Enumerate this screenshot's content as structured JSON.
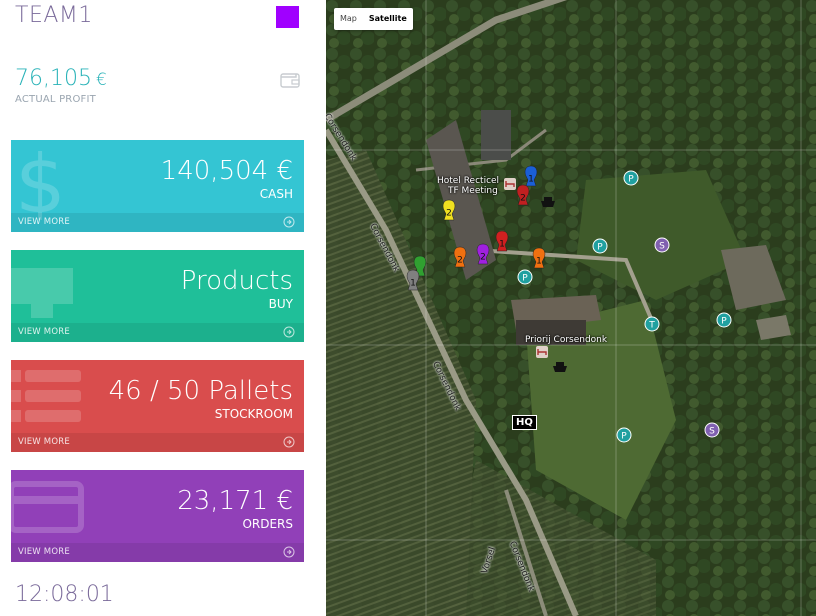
{
  "team": {
    "name": "TEAM1",
    "color": "#a000ff"
  },
  "profit": {
    "value": "76,105",
    "currency": "€",
    "label": "ACTUAL PROFIT"
  },
  "cards": [
    {
      "key": "cash",
      "value": "140,504 €",
      "sub": "CASH",
      "footer": "VIEW MORE",
      "color": "#34c5d3",
      "icon": "dollar-icon"
    },
    {
      "key": "products",
      "value": "Products",
      "sub": "BUY",
      "footer": "VIEW MORE",
      "color": "#1fbf99",
      "icon": "monitor-icon"
    },
    {
      "key": "stockroom",
      "value": "46 / 50 Pallets",
      "sub": "STOCKROOM",
      "footer": "VIEW MORE",
      "color": "#d94d4d",
      "icon": "list-icon"
    },
    {
      "key": "orders",
      "value": "23,171 €",
      "sub": "ORDERS",
      "footer": "VIEW MORE",
      "color": "#9140b8",
      "icon": "card-icon"
    }
  ],
  "clock": "12:08:01",
  "map": {
    "type_buttons": [
      "Map",
      "Satellite"
    ],
    "active_type": "Satellite",
    "places": [
      "Hotel Recticel",
      "TF Meeting",
      "Priorij Corsendonk"
    ],
    "roads": [
      "Corsendonk",
      "Corsendonk",
      "Corsendonk",
      "Corsendonk",
      "Vorsel"
    ],
    "hq_label": "HQ",
    "markers": [
      {
        "kind": "team-pin",
        "label": "1",
        "color": "#1a5fd6"
      },
      {
        "kind": "team-pin",
        "label": "2",
        "color": "#c02020"
      },
      {
        "kind": "team-pin",
        "label": "2",
        "color": "#f0e020"
      },
      {
        "kind": "team-pin",
        "label": "1",
        "color": "#d02020"
      },
      {
        "kind": "team-pin",
        "label": "2",
        "color": "#a020e0"
      },
      {
        "kind": "team-pin",
        "label": "2",
        "color": "#f07010"
      },
      {
        "kind": "team-pin",
        "label": "1",
        "color": "#f07010"
      },
      {
        "kind": "team-pin",
        "label": "",
        "color": "#30a030"
      },
      {
        "kind": "team-pin",
        "label": "1",
        "color": "#808080"
      },
      {
        "kind": "parking",
        "label": "P",
        "color": "#20a0a0"
      },
      {
        "kind": "parking",
        "label": "P",
        "color": "#20a0a0"
      },
      {
        "kind": "parking",
        "label": "P",
        "color": "#20a0a0"
      },
      {
        "kind": "parking",
        "label": "P",
        "color": "#20a0a0"
      },
      {
        "kind": "parking",
        "label": "P",
        "color": "#20a0a0"
      },
      {
        "kind": "parking",
        "label": "T",
        "color": "#20a0a0"
      },
      {
        "kind": "supplier",
        "label": "S",
        "color": "#8060b0"
      },
      {
        "kind": "supplier",
        "label": "S",
        "color": "#8060b0"
      }
    ]
  }
}
